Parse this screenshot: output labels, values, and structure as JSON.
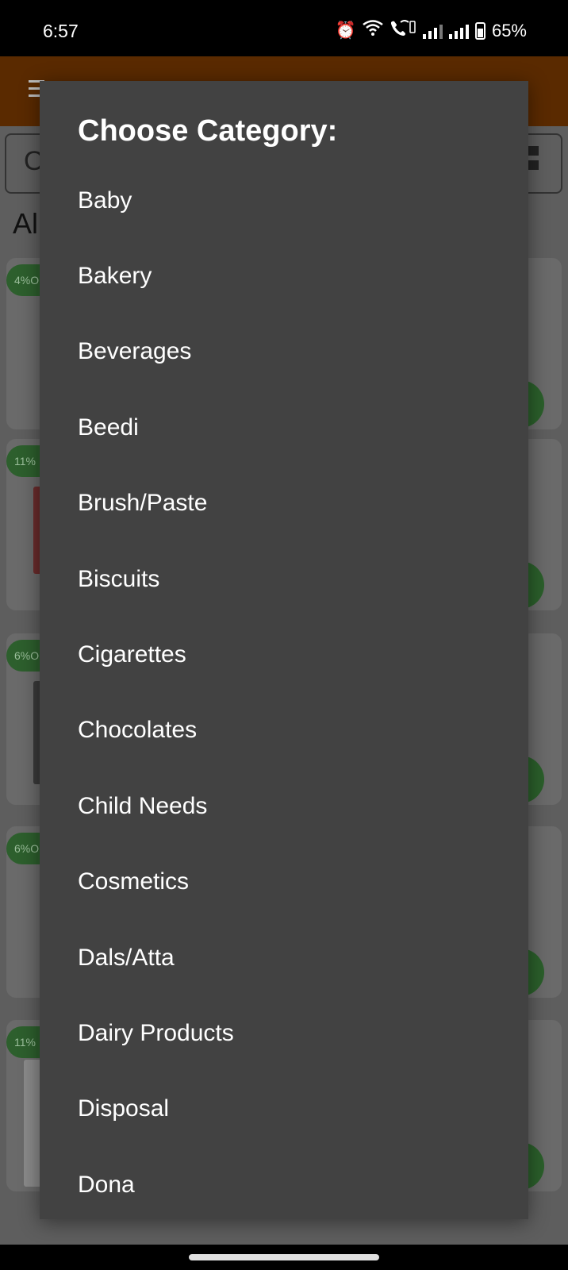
{
  "status_bar": {
    "time": "6:57",
    "battery": "65%",
    "icons": [
      "alarm-icon",
      "wifi-icon",
      "wifi-calling-icon",
      "signal-icon",
      "signal-icon",
      "battery-icon"
    ]
  },
  "background": {
    "section_title_partial": "Al",
    "badges": [
      "4%O",
      "11%",
      "6%O",
      "6%O",
      "11%"
    ]
  },
  "dialog": {
    "title": "Choose Category:",
    "categories": [
      "Baby",
      "Bakery",
      "Beverages",
      "Beedi",
      "Brush/Paste",
      "Biscuits",
      "Cigarettes",
      "Chocolates",
      "Child Needs",
      "Cosmetics",
      "Dals/Atta",
      "Dairy Products",
      "Disposal",
      "Dona"
    ]
  },
  "colors": {
    "dialog_bg": "#424242",
    "header_bg": "#5a2a00",
    "badge_green": "#2d5f2d"
  }
}
